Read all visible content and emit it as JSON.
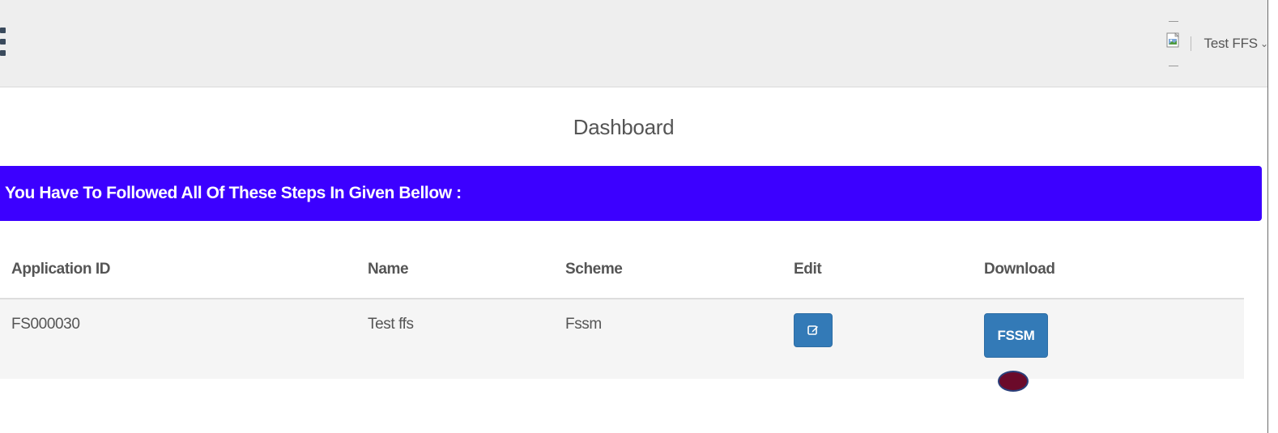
{
  "header": {
    "user_name": "Test FFS",
    "caret": "⌄"
  },
  "page": {
    "title": "Dashboard"
  },
  "banner": {
    "text": "You Have To Followed All Of These Steps In Given Bellow :",
    "color": "#3c00ff"
  },
  "table": {
    "columns": [
      "Application ID",
      "Name",
      "Scheme",
      "Edit",
      "Download"
    ],
    "rows": [
      {
        "application_id": "FS000030",
        "name": "Test ffs",
        "scheme": "Fssm",
        "download_label": "FSSM"
      }
    ]
  },
  "colors": {
    "accent": "#337ab7",
    "cursor": "#6b0a2a"
  }
}
